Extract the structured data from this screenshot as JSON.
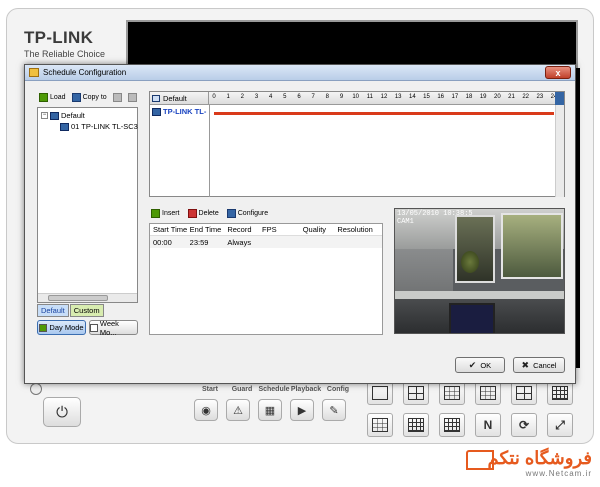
{
  "brand": {
    "title": "TP-LINK",
    "subtitle": "The Reliable Choice"
  },
  "dialog": {
    "title": "Schedule Configuration",
    "close_label": "x",
    "toolbar": {
      "load": "Load",
      "copy_to": "Copy to"
    },
    "tree": {
      "root": "Default",
      "child": "01 TP-LINK TL-SC3"
    },
    "tabs": {
      "default": "Default",
      "custom": "Custom"
    },
    "modes": {
      "day": "Day Mode",
      "week": "Week Mo..."
    },
    "timeline": {
      "header": "Default",
      "row_label": "TP-LINK TL-",
      "hours": [
        "0",
        "1",
        "2",
        "3",
        "4",
        "5",
        "6",
        "7",
        "8",
        "9",
        "10",
        "11",
        "12",
        "13",
        "14",
        "15",
        "16",
        "17",
        "18",
        "19",
        "20",
        "21",
        "22",
        "23",
        "24"
      ]
    },
    "actions": {
      "insert": "Insert",
      "delete": "Delete",
      "configure": "Configure"
    },
    "table": {
      "headers": [
        "Start Time",
        "End Time",
        "Record",
        "FPS",
        "Quality",
        "Resolution"
      ],
      "rows": [
        [
          "00:00",
          "23:59",
          "Always",
          "",
          "",
          ""
        ]
      ]
    },
    "preview": {
      "timestamp": "13/05/2010 10:38:5",
      "camera": "CAM1"
    },
    "buttons": {
      "ok": "OK",
      "cancel": "Cancel"
    }
  },
  "controls": {
    "labels": [
      "Start",
      "Guard",
      "Schedule",
      "Playback",
      "Config"
    ]
  },
  "watermark": {
    "logo": "فروشگاه نتکم",
    "url": "www.Netcam.ir"
  },
  "colors": {
    "accent": "#d93a1a",
    "brand_orange": "#e65a1e",
    "link_blue": "#1a44c0"
  }
}
